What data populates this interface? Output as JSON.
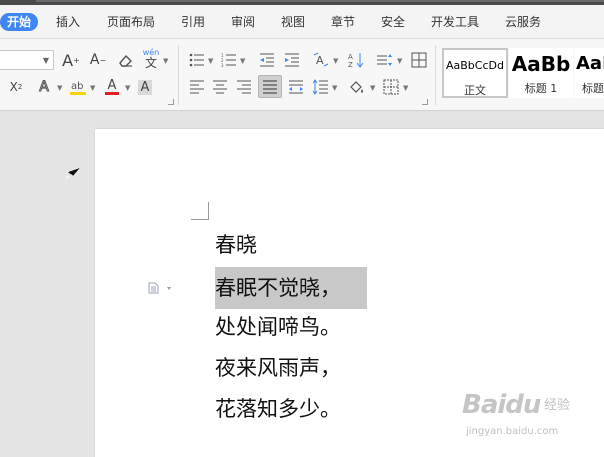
{
  "tabs": [
    {
      "label": "开始",
      "active": true
    },
    {
      "label": "插入"
    },
    {
      "label": "页面布局"
    },
    {
      "label": "引用"
    },
    {
      "label": "审阅"
    },
    {
      "label": "视图"
    },
    {
      "label": "章节"
    },
    {
      "label": "安全"
    },
    {
      "label": "开发工具"
    },
    {
      "label": "云服务"
    }
  ],
  "ribbon": {
    "font_size_value": "",
    "font_grow": "A",
    "font_shrink": "A",
    "subscript_label": "X",
    "text_effect_label": "A",
    "font_color_label": "A",
    "char_shade_label": "A",
    "pinyin_label": "wén",
    "colors": {
      "highlight": "#f5d40f",
      "font_color": "#e02020",
      "accent": "#3f86f5"
    }
  },
  "styles": [
    {
      "sample": "AaBbCcDd",
      "name": "正文",
      "selected": true
    },
    {
      "sample": "AaBb",
      "name": "标题 1"
    },
    {
      "sample": "AaB",
      "name": "标题"
    }
  ],
  "document": {
    "lines": [
      "春晓",
      "春眠不觉晓，",
      "处处闻啼鸟。",
      "夜来风雨声，",
      "花落知多少。"
    ],
    "highlighted_line": 1
  },
  "watermark": {
    "brand": "Baidu",
    "brand_suffix": "经验",
    "url": "jingyan.baidu.com"
  }
}
